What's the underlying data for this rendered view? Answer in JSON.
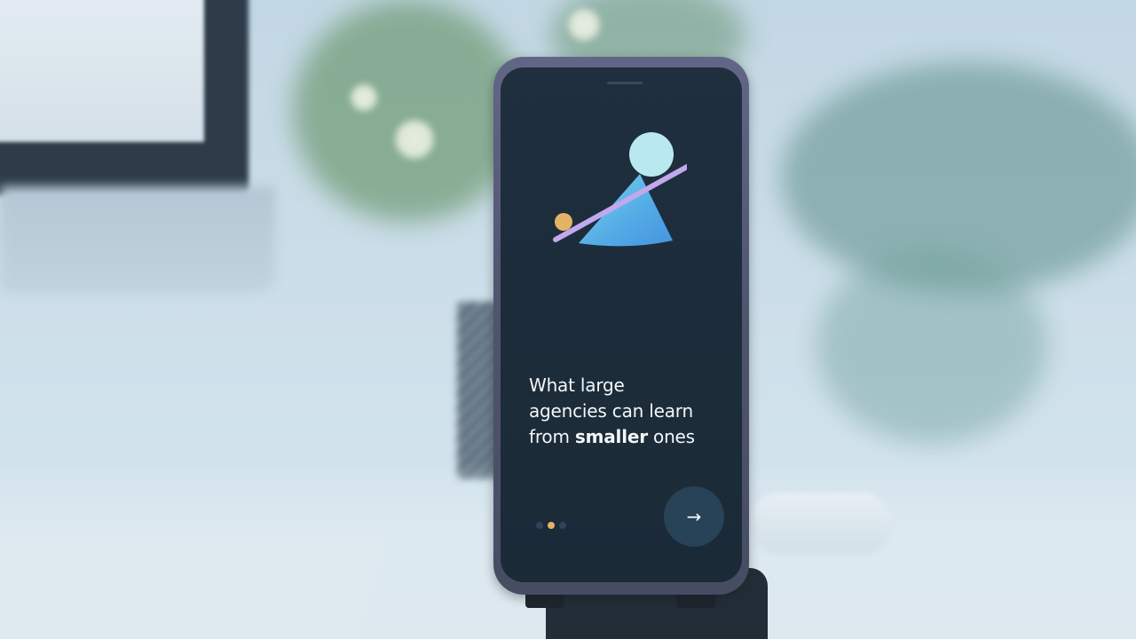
{
  "screen": {
    "headline": {
      "line1": "What large",
      "line2": "agencies can learn",
      "line3_prefix": "from ",
      "line3_bold": "smaller",
      "line3_suffix": " ones"
    },
    "pagination": {
      "total": 3,
      "active_index": 1
    },
    "next_button": {
      "icon": "arrow-right-icon",
      "glyph": "→"
    }
  },
  "colors": {
    "screen_background": "#0f1c2a",
    "accent_orange": "#f0b257",
    "accent_cyan": "#bfeef5",
    "accent_purple": "#c9a6f0",
    "button_background": "#1a3146",
    "text": "#ffffff"
  }
}
